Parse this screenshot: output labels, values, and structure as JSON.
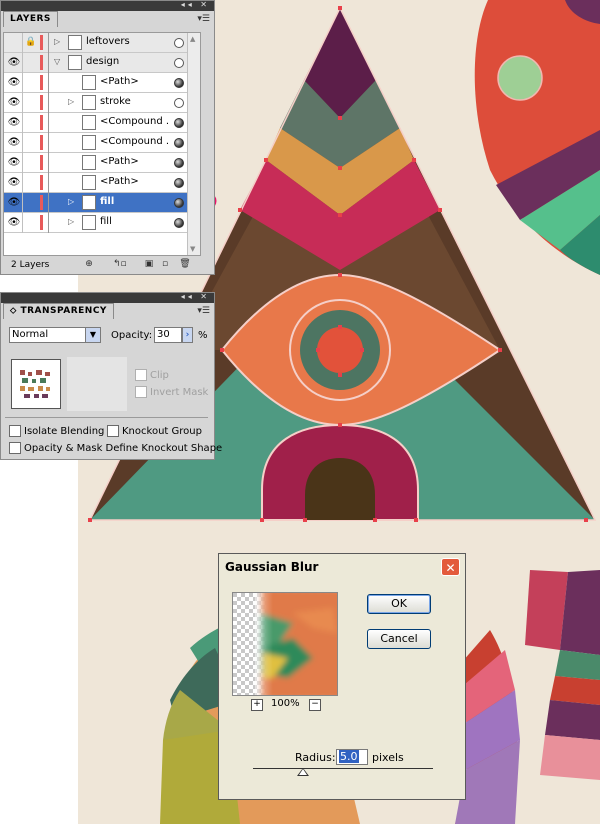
{
  "colors": {
    "canvas_bg": "#efe6d8",
    "highlight_ring": "#e8136a",
    "selection_blue": "#3f72c4",
    "path_red": "#e8404a"
  },
  "layers_panel": {
    "tab_label": "LAYERS",
    "layers_count": "2 Layers",
    "rows": [
      {
        "name": "leftovers",
        "type": "layer",
        "expanded": false,
        "target": "empty"
      },
      {
        "name": "design",
        "type": "layer",
        "expanded": true,
        "target": "empty"
      },
      {
        "name": "<Path>",
        "type": "path",
        "target": "filled"
      },
      {
        "name": "stroke",
        "type": "group",
        "target": "empty"
      },
      {
        "name": "<Compound ...",
        "type": "path",
        "target": "filled"
      },
      {
        "name": "<Compound ...",
        "type": "path",
        "target": "filled"
      },
      {
        "name": "<Path>",
        "type": "path",
        "target": "filled"
      },
      {
        "name": "<Path>",
        "type": "path",
        "target": "filled"
      },
      {
        "name": "fill",
        "type": "group",
        "target": "filled",
        "selected": true
      },
      {
        "name": "fill",
        "type": "group",
        "target": "filled"
      }
    ]
  },
  "transparency_panel": {
    "tab_label": "TRANSPARENCY",
    "blend_mode": "Normal",
    "opacity_label": "Opacity:",
    "opacity_value": "30",
    "opacity_unit": "%",
    "clip_label": "Clip",
    "invert_mask_label": "Invert Mask",
    "isolate_blending_label": "Isolate Blending",
    "knockout_group_label": "Knockout Group",
    "opacity_mask_label": "Opacity & Mask Define Knockout Shape"
  },
  "gaussian_blur_dialog": {
    "title": "Gaussian Blur",
    "ok_label": "OK",
    "cancel_label": "Cancel",
    "zoom_level": "100%",
    "radius_label": "Radius:",
    "radius_value": "5.0",
    "radius_unit": "pixels",
    "radius_slider_fraction": 0.28
  }
}
